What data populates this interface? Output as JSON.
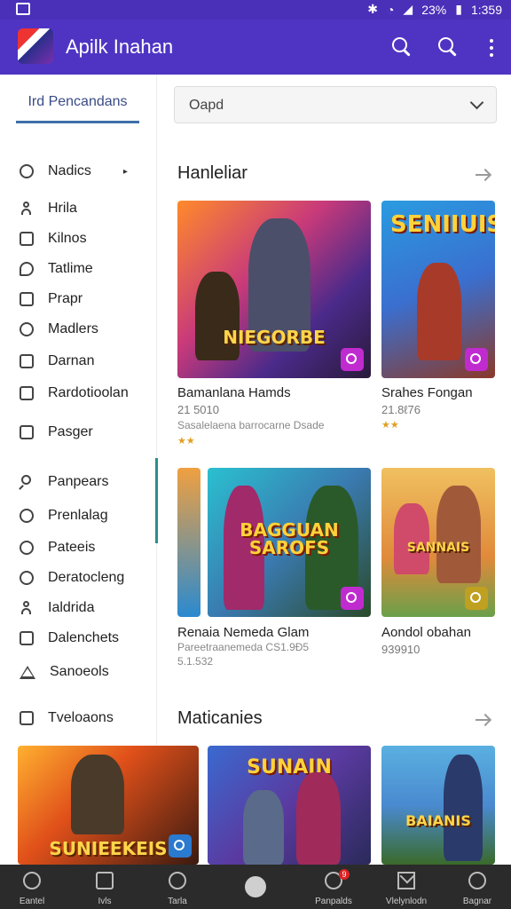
{
  "status_bar": {
    "time": "1:359",
    "battery": "23%"
  },
  "app_bar": {
    "title": "Apilk Inahan"
  },
  "sidebar": {
    "tab_label": "Ird Pencandans",
    "items": [
      {
        "label": "Nadics",
        "icon": "circle-icon"
      },
      {
        "label": "Hrila",
        "icon": "person-icon"
      },
      {
        "label": "Kilnos",
        "icon": "square-icon"
      },
      {
        "label": "Tatlime",
        "icon": "bubble-icon"
      },
      {
        "label": "Prapr",
        "icon": "square-icon"
      },
      {
        "label": "Madlers",
        "icon": "circle-icon"
      },
      {
        "label": "Darnan",
        "icon": "square-icon"
      },
      {
        "label": "Rardotioolan",
        "icon": "square-icon"
      },
      {
        "label": "Pasger",
        "icon": "square-icon"
      },
      {
        "label": "Panpears",
        "icon": "search-icon"
      },
      {
        "label": "Prenlalag",
        "icon": "circle-icon"
      },
      {
        "label": "Pateeis",
        "icon": "circle-icon"
      },
      {
        "label": "Deratocleng",
        "icon": "circle-icon"
      },
      {
        "label": "Ialdrida",
        "icon": "person-icon"
      },
      {
        "label": "Dalenchets",
        "icon": "square-icon"
      },
      {
        "label": "Sanoeols",
        "icon": "triangle-icon"
      },
      {
        "label": "Tveloaons",
        "icon": "square-icon"
      }
    ]
  },
  "filter": {
    "value": "Oapd"
  },
  "sections": [
    {
      "title": "Hanleliar"
    },
    {
      "title": "Maticanies"
    }
  ],
  "games": [
    {
      "title": "Bamanlana Hamds",
      "meta": "21 5010",
      "sub": "Sasalelaena barrocarne Dsade",
      "art": "NIEGORBE",
      "stars": "★★"
    },
    {
      "title": "Srahes Fongan",
      "meta": "21.8ℓ76",
      "sub": "",
      "art": "SENIIUIS",
      "stars": "★★"
    },
    {
      "title": "Renaia Nemeda Glam",
      "meta": "Pareetraanemeda CS1.9Ð5",
      "sub": "Pareetraanemeda CS1.9Ð5",
      "art": "BAGGUAN SAROFS",
      "stars": ""
    },
    {
      "title": "Aondol obahan",
      "meta": "939910",
      "sub": "",
      "art": "SANNAIS",
      "stars": ""
    },
    {
      "title": "",
      "meta": "",
      "sub": "",
      "art": "SUNIEEKEIS",
      "stars": ""
    },
    {
      "title": "",
      "meta": "",
      "sub": "",
      "art": "SUNAIN",
      "stars": ""
    },
    {
      "title": "",
      "meta": "",
      "sub": "",
      "art": "BAIANIS",
      "stars": ""
    }
  ],
  "game3_rating": "5.1.532",
  "bottom_nav": [
    {
      "label": "Eantel"
    },
    {
      "label": "Ivls"
    },
    {
      "label": "Tarla"
    },
    {
      "label": ""
    },
    {
      "label": "Panpalds"
    },
    {
      "label": "Vlelynlodn"
    },
    {
      "label": "Bagnar"
    }
  ],
  "notification_count": "9"
}
